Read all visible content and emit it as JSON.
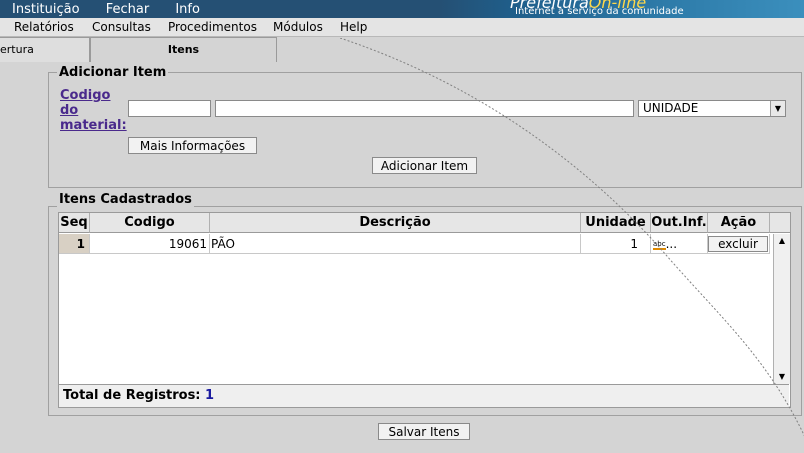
{
  "top_menu": [
    "Instituição",
    "Fechar",
    "Info"
  ],
  "banner": {
    "logo_part1": "Prefeitura",
    "logo_part2": "On-line",
    "tagline": "Internet a serviço da comunidade"
  },
  "menubar": [
    "Relatórios",
    "Consultas",
    "Procedimentos",
    "Módulos",
    "Help"
  ],
  "tabs": {
    "prev": "ertura",
    "active": "Itens"
  },
  "add_item": {
    "legend": "Adicionar Item",
    "codigo_link": [
      "Codigo",
      "do",
      "material:"
    ],
    "codigo_value": "",
    "descricao_value": "",
    "unit_selected": "UNIDADE",
    "mais_info_button": "Mais Informações",
    "add_button": "Adicionar Item"
  },
  "itens": {
    "legend": "Itens Cadastrados",
    "columns": [
      "Seq",
      "Codigo",
      "Descrição",
      "Unidade",
      "Out.Inf.",
      "Ação"
    ],
    "rows": [
      {
        "seq": "1",
        "codigo": "19061",
        "descricao": "PÃO",
        "unidade": "1",
        "outinf": "...",
        "acao": "excluir"
      }
    ],
    "total_label": "Total de Registros:",
    "total_value": "1"
  },
  "save_button": "Salvar Itens",
  "colors": {
    "topbar": "#255074",
    "link": "#4a2a8c"
  }
}
